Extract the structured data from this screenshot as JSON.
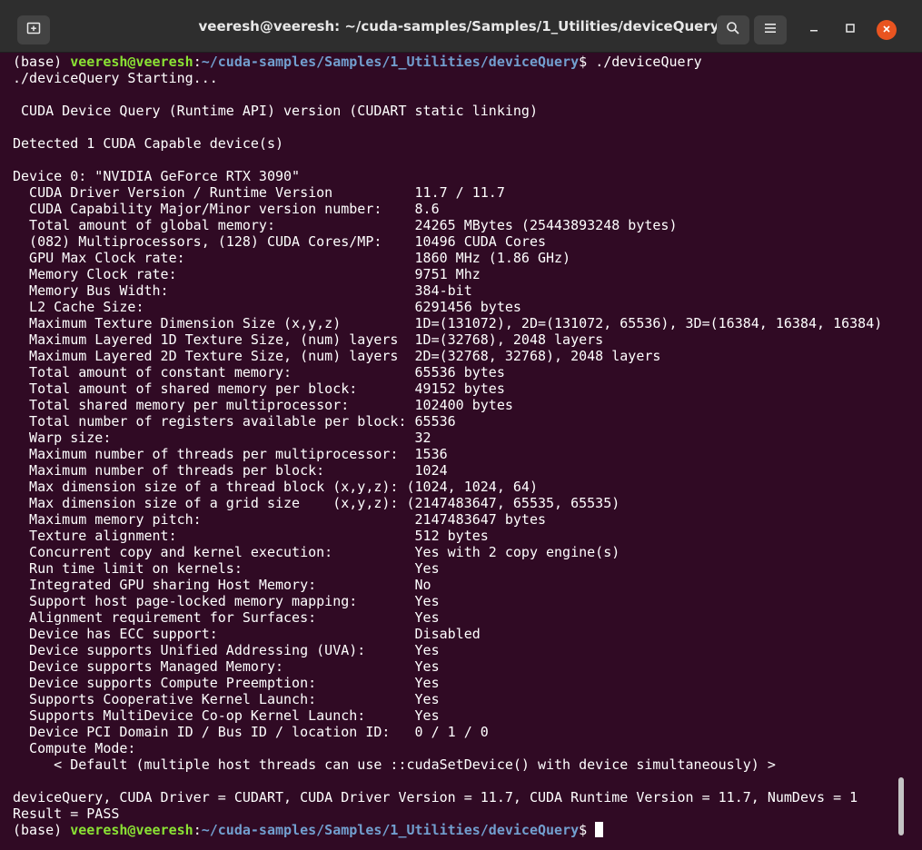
{
  "window": {
    "title": "veeresh@veeresh: ~/cuda-samples/Samples/1_Utilities/deviceQuery"
  },
  "prompt": {
    "env": "(base) ",
    "user_host": "veeresh@veeresh",
    "sep": ":",
    "path": "~/cuda-samples/Samples/1_Utilities/deviceQuery",
    "symbol": "$ ",
    "command": "./deviceQuery"
  },
  "output": [
    "./deviceQuery Starting...",
    "",
    " CUDA Device Query (Runtime API) version (CUDART static linking)",
    "",
    "Detected 1 CUDA Capable device(s)",
    "",
    "Device 0: \"NVIDIA GeForce RTX 3090\"",
    "  CUDA Driver Version / Runtime Version          11.7 / 11.7",
    "  CUDA Capability Major/Minor version number:    8.6",
    "  Total amount of global memory:                 24265 MBytes (25443893248 bytes)",
    "  (082) Multiprocessors, (128) CUDA Cores/MP:    10496 CUDA Cores",
    "  GPU Max Clock rate:                            1860 MHz (1.86 GHz)",
    "  Memory Clock rate:                             9751 Mhz",
    "  Memory Bus Width:                              384-bit",
    "  L2 Cache Size:                                 6291456 bytes",
    "  Maximum Texture Dimension Size (x,y,z)         1D=(131072), 2D=(131072, 65536), 3D=(16384, 16384, 16384)",
    "  Maximum Layered 1D Texture Size, (num) layers  1D=(32768), 2048 layers",
    "  Maximum Layered 2D Texture Size, (num) layers  2D=(32768, 32768), 2048 layers",
    "  Total amount of constant memory:               65536 bytes",
    "  Total amount of shared memory per block:       49152 bytes",
    "  Total shared memory per multiprocessor:        102400 bytes",
    "  Total number of registers available per block: 65536",
    "  Warp size:                                     32",
    "  Maximum number of threads per multiprocessor:  1536",
    "  Maximum number of threads per block:           1024",
    "  Max dimension size of a thread block (x,y,z): (1024, 1024, 64)",
    "  Max dimension size of a grid size    (x,y,z): (2147483647, 65535, 65535)",
    "  Maximum memory pitch:                          2147483647 bytes",
    "  Texture alignment:                             512 bytes",
    "  Concurrent copy and kernel execution:          Yes with 2 copy engine(s)",
    "  Run time limit on kernels:                     Yes",
    "  Integrated GPU sharing Host Memory:            No",
    "  Support host page-locked memory mapping:       Yes",
    "  Alignment requirement for Surfaces:            Yes",
    "  Device has ECC support:                        Disabled",
    "  Device supports Unified Addressing (UVA):      Yes",
    "  Device supports Managed Memory:                Yes",
    "  Device supports Compute Preemption:            Yes",
    "  Supports Cooperative Kernel Launch:            Yes",
    "  Supports MultiDevice Co-op Kernel Launch:      Yes",
    "  Device PCI Domain ID / Bus ID / location ID:   0 / 1 / 0",
    "  Compute Mode:",
    "     < Default (multiple host threads can use ::cudaSetDevice() with device simultaneously) >",
    "",
    "deviceQuery, CUDA Driver = CUDART, CUDA Driver Version = 11.7, CUDA Runtime Version = 11.7, NumDevs = 1",
    "Result = PASS"
  ],
  "icons": {
    "new_tab": "new-tab-icon",
    "search": "search-icon",
    "menu": "hamburger-menu-icon",
    "minimize": "minimize-icon",
    "maximize": "maximize-icon",
    "close": "close-icon"
  },
  "colors": {
    "terminal_bg": "#300a24",
    "titlebar_bg": "#2e2e2e",
    "prompt_user": "#8ae234",
    "prompt_path": "#729fcf",
    "close_button": "#e95420"
  }
}
